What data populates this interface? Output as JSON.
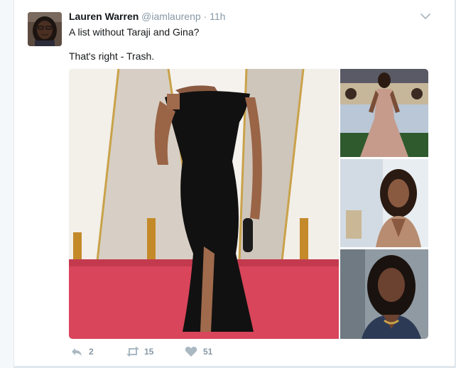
{
  "tweet": {
    "author_name": "Lauren Warren",
    "handle": "@iamlaurenp",
    "separator": "·",
    "time": "11h",
    "text_line1": "A list without Taraji and Gina?",
    "text_line2": "That's right - Trash."
  },
  "actions": {
    "reply_count": "2",
    "retweet_count": "15",
    "like_count": "51"
  },
  "icons": {
    "reply": "reply-icon",
    "retweet": "retweet-icon",
    "like": "heart-icon",
    "menu": "chevron-down-icon"
  },
  "colors": {
    "name": "#14171a",
    "meta": "#8899a6",
    "carpet": "#d9455a",
    "gown": "#111111"
  }
}
